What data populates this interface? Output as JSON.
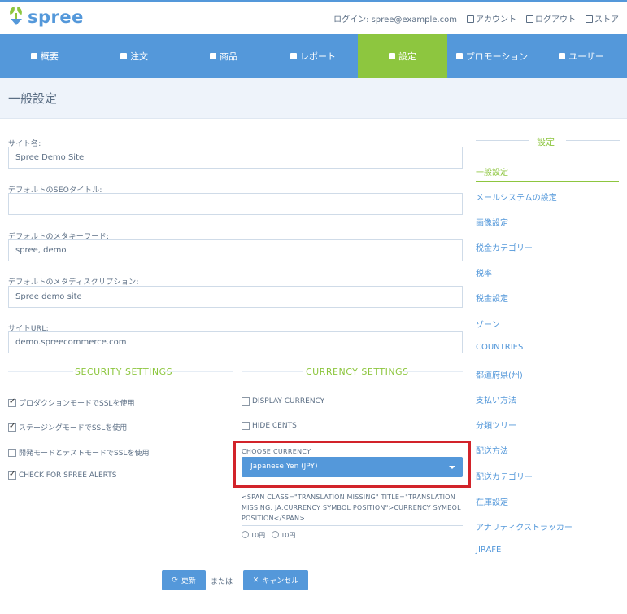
{
  "brand": {
    "name": "spree"
  },
  "top_links": [
    {
      "label": "ログイン: spree@example.com",
      "icon": ""
    },
    {
      "label": "アカウント",
      "icon": "user-icon"
    },
    {
      "label": "ログアウト",
      "icon": "logout-icon"
    },
    {
      "label": "ストア",
      "icon": "external-link-icon"
    }
  ],
  "nav": [
    {
      "label": "概要",
      "icon": "dashboard-icon"
    },
    {
      "label": "注文",
      "icon": "cart-icon"
    },
    {
      "label": "商品",
      "icon": "grid-icon"
    },
    {
      "label": "レポート",
      "icon": "report-icon"
    },
    {
      "label": "設定",
      "icon": "wrench-icon",
      "active": true
    },
    {
      "label": "プロモーション",
      "icon": "bullhorn-icon"
    },
    {
      "label": "ユーザー",
      "icon": "user-icon"
    }
  ],
  "page": {
    "title": "一般設定"
  },
  "form": {
    "site_name": {
      "label": "サイト名:",
      "value": "Spree Demo Site"
    },
    "seo_title": {
      "label": "デフォルトのSEOタイトル:",
      "value": ""
    },
    "meta_keywords": {
      "label": "デフォルトのメタキーワード:",
      "value": "spree, demo"
    },
    "meta_description": {
      "label": "デフォルトのメタディスクリプション:",
      "value": "Spree demo site"
    },
    "site_url": {
      "label": "サイトURL:",
      "value": "demo.spreecommerce.com"
    }
  },
  "security": {
    "heading": "SECURITY SETTINGS",
    "options": [
      {
        "label": "プロダクションモードでSSLを使用",
        "checked": true
      },
      {
        "label": "ステージングモードでSSLを使用",
        "checked": true
      },
      {
        "label": "開発モードとテストモードでSSLを使用",
        "checked": false
      },
      {
        "label": "CHECK FOR SPREE ALERTS",
        "checked": true
      }
    ]
  },
  "currency": {
    "heading": "CURRENCY SETTINGS",
    "options": [
      {
        "label": "DISPLAY CURRENCY",
        "checked": false
      },
      {
        "label": "HIDE CENTS",
        "checked": false
      }
    ],
    "choose_label": "CHOOSE CURRENCY",
    "selected": "Japanese Yen (JPY)",
    "missing_text": "<SPAN CLASS=\"TRANSLATION MISSING\" TITLE=\"TRANSLATION MISSING: JA.CURRENCY SYMBOL POSITION\">CURRENCY SYMBOL POSITION</SPAN>",
    "positions": [
      "10円",
      "10円"
    ]
  },
  "actions": {
    "update": "更新",
    "or": "または",
    "cancel": "キャンセル"
  },
  "sidebar": {
    "heading": "設定",
    "items": [
      {
        "label": "一般設定",
        "active": true
      },
      {
        "label": "メールシステムの設定"
      },
      {
        "label": "画像設定"
      },
      {
        "label": "税金カテゴリー"
      },
      {
        "label": "税率"
      },
      {
        "label": "税金設定"
      },
      {
        "label": "ゾーン"
      },
      {
        "label": "COUNTRIES"
      },
      {
        "label": "都道府県(州)"
      },
      {
        "label": "支払い方法"
      },
      {
        "label": "分類ツリー"
      },
      {
        "label": "配送方法"
      },
      {
        "label": "配送カテゴリー"
      },
      {
        "label": "在庫設定"
      },
      {
        "label": "アナリティクストラッカー"
      },
      {
        "label": "JIRAFE"
      }
    ]
  },
  "colors": {
    "primary": "#5498da",
    "accent": "#8dc63f",
    "highlight": "#d2232a"
  }
}
